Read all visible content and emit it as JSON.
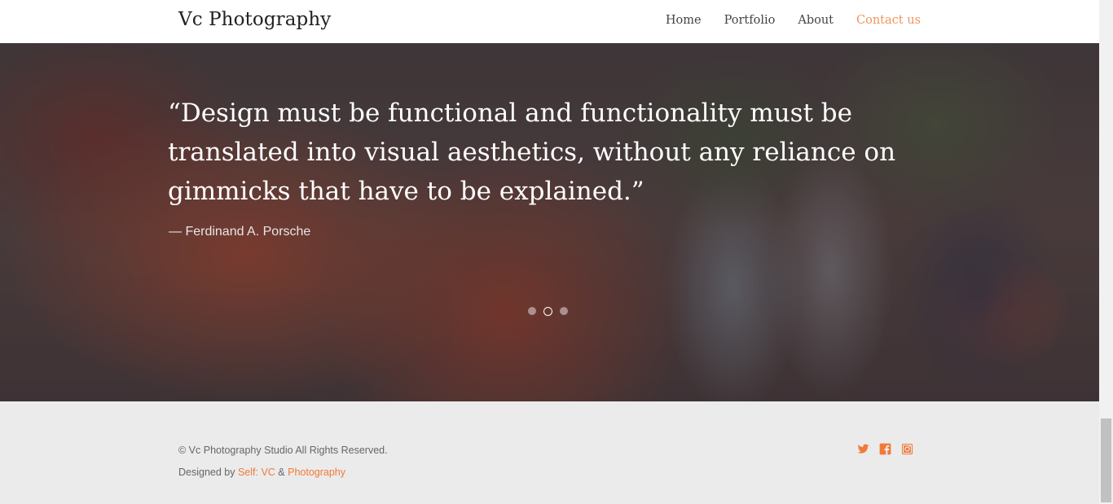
{
  "header": {
    "brand": "Vc Photography",
    "nav": [
      {
        "label": "Home",
        "active": false
      },
      {
        "label": "Portfolio",
        "active": false
      },
      {
        "label": "About",
        "active": false
      },
      {
        "label": "Contact us",
        "active": true
      }
    ]
  },
  "hero": {
    "quote": "“Design must be functional and functionality must be translated into visual aesthetics, without any reliance on gimmicks that have to be explained.”",
    "author": "— Ferdinand A. Porsche",
    "slides": {
      "count": 3,
      "active_index": 1
    }
  },
  "footer": {
    "copyright": "© Vc Photography Studio All Rights Reserved.",
    "designed_prefix": "Designed by ",
    "designer_link": "Self: VC",
    "separator": " & ",
    "designer_link2": "Photography",
    "social_icons": [
      "twitter-icon",
      "facebook-icon",
      "instagram-icon"
    ],
    "accent_color": "#f07a3a"
  },
  "colors": {
    "active_nav": "#f0955c",
    "accent": "#f07a3a"
  }
}
